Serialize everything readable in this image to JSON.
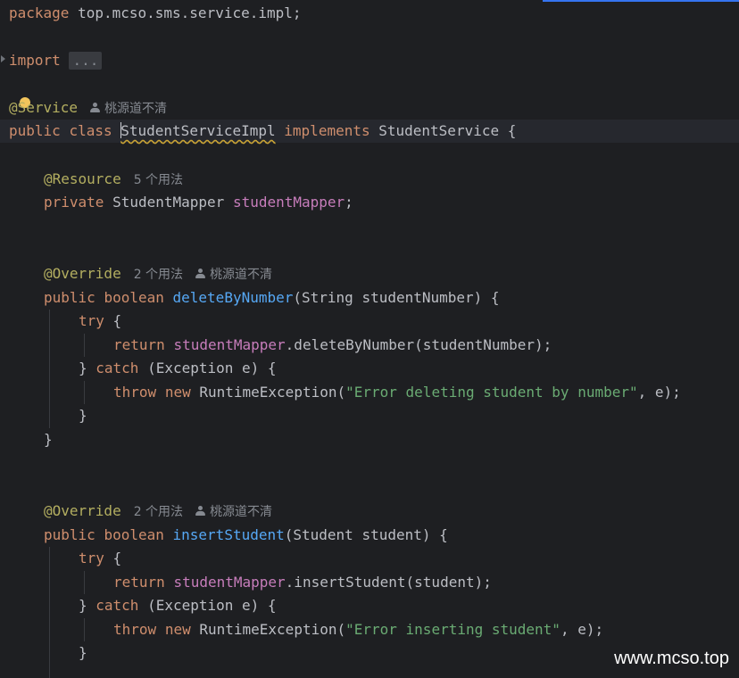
{
  "editor": {
    "package_kw": "package",
    "package_name": " top.mcso.sms.service.impl;",
    "import_kw": "import",
    "import_fold": "...",
    "class_annotation": "@Service",
    "author": "桃源道不清",
    "class_line": {
      "public": "public",
      "class": "class",
      "name": "StudentServiceImpl",
      "implements": "implements",
      "interface": " StudentService {"
    },
    "resource_annotation": "@Resource",
    "resource_usages": "5 个用法",
    "field_line": {
      "private": "private",
      "type": " StudentMapper ",
      "name": "studentMapper",
      "end": ";"
    },
    "method1": {
      "annotation": "@Override",
      "usages": "2 个用法",
      "author": "桃源道不清",
      "public": "public",
      "boolean": "boolean",
      "name": "deleteByNumber",
      "params": "(String studentNumber) {",
      "try": "try",
      "try_brace": " {",
      "return": "return",
      "field": "studentMapper",
      "call": ".deleteByNumber(studentNumber);",
      "close_brace": "} ",
      "catch": "catch",
      "catch_params": " (Exception e) {",
      "throw": "throw",
      "new": "new",
      "exception": " RuntimeException(",
      "message": "\"Error deleting student by number\"",
      "args_end": ", e);",
      "brace_inner": "}",
      "brace_outer": "}"
    },
    "method2": {
      "annotation": "@Override",
      "usages": "2 个用法",
      "author": "桃源道不清",
      "public": "public",
      "boolean": "boolean",
      "name": "insertStudent",
      "params": "(Student student) {",
      "try": "try",
      "try_brace": " {",
      "return": "return",
      "field": "studentMapper",
      "call": ".insertStudent(student);",
      "close_brace": "} ",
      "catch": "catch",
      "catch_params": " (Exception e) {",
      "throw": "throw",
      "new": "new",
      "exception": " RuntimeException(",
      "message": "\"Error inserting student\"",
      "args_end": ", e);",
      "brace_inner": "}"
    }
  },
  "watermark": "www.mcso.top",
  "colors": {
    "background": "#1e1f22",
    "keyword": "#cf8e6d",
    "annotation": "#b3ae60",
    "field": "#c77dbb",
    "method": "#56a8f5",
    "string": "#6aab73",
    "text": "#bcbec4",
    "hint": "#868a91"
  }
}
